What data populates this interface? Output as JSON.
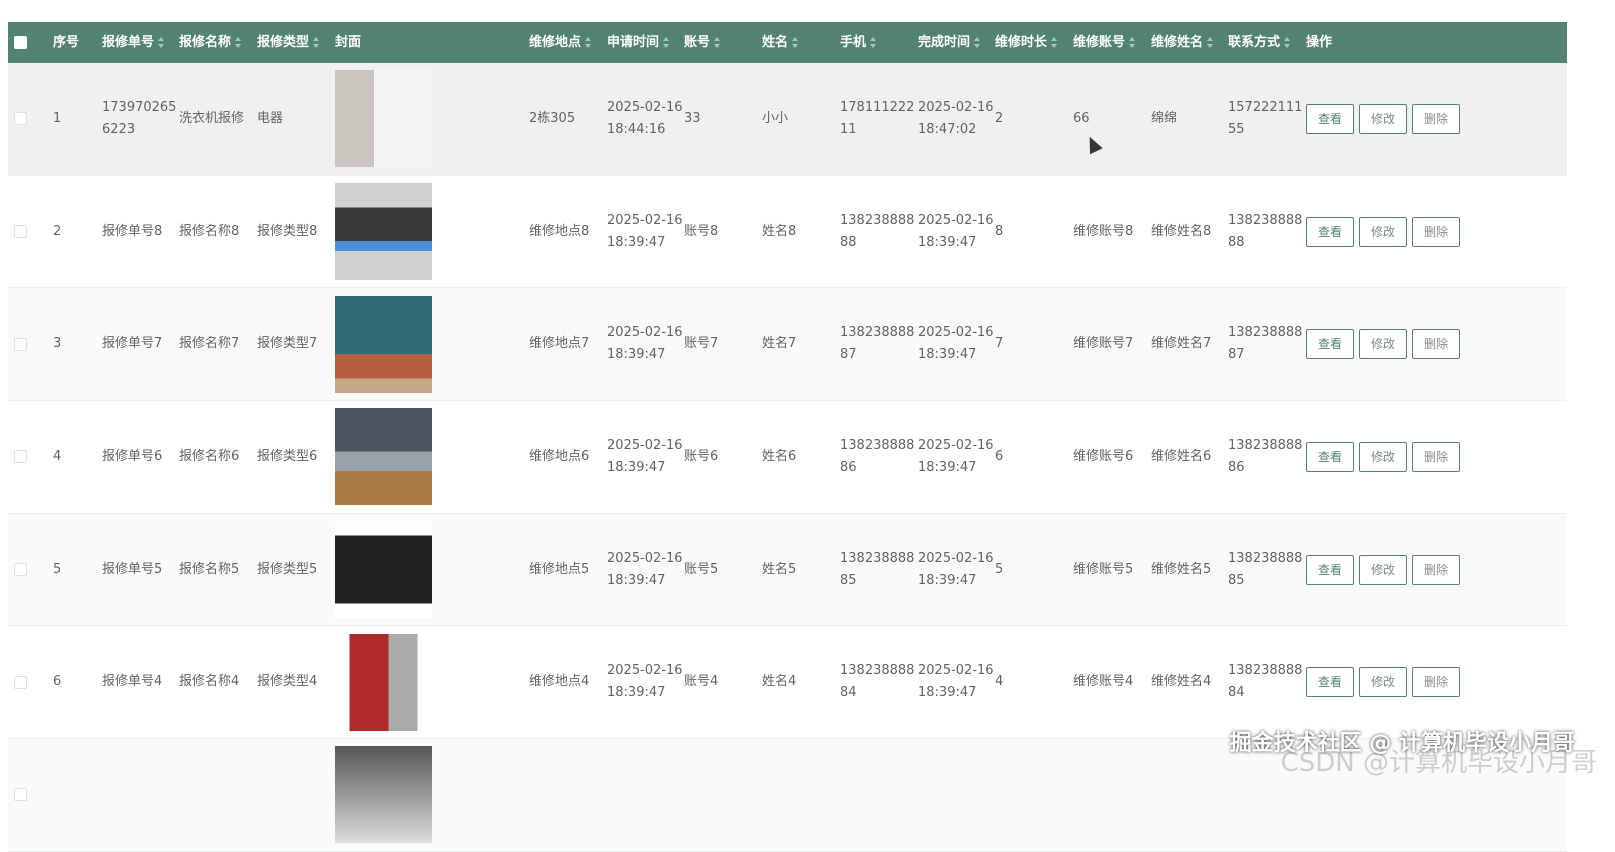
{
  "columns": [
    "序号",
    "报修单号",
    "报修名称",
    "报修类型",
    "封面",
    "维修地点",
    "申请时间",
    "账号",
    "姓名",
    "手机",
    "完成时间",
    "维修时长",
    "维修账号",
    "维修姓名",
    "联系方式",
    "操作"
  ],
  "sortable": [
    false,
    true,
    true,
    true,
    false,
    true,
    true,
    true,
    true,
    true,
    true,
    true,
    true,
    true,
    true,
    false
  ],
  "actions": {
    "view": "查看",
    "edit": "修改",
    "delete": "删除"
  },
  "rows": [
    {
      "idx": "1",
      "no": "1739702656223",
      "name": "洗衣机报修",
      "type": "电器",
      "cover": "washing-machine",
      "place": "2栋305",
      "apply": "2025-02-16 18:44:16",
      "account": "33",
      "uname": "小小",
      "phone": "17811122211",
      "done": "2025-02-16 18:47:02",
      "dur": "2",
      "racc": "66",
      "rname": "绵绵",
      "contact": "15722211155"
    },
    {
      "idx": "2",
      "no": "报修单号8",
      "name": "报修名称8",
      "type": "报修类型8",
      "cover": "air-conditioner",
      "place": "维修地点8",
      "apply": "2025-02-16 18:39:47",
      "account": "账号8",
      "uname": "姓名8",
      "phone": "13823888888",
      "done": "2025-02-16 18:39:47",
      "dur": "8",
      "racc": "维修账号8",
      "rname": "维修姓名8",
      "contact": "13823888888"
    },
    {
      "idx": "3",
      "no": "报修单号7",
      "name": "报修名称7",
      "type": "报修类型7",
      "cover": "food-processor",
      "place": "维修地点7",
      "apply": "2025-02-16 18:39:47",
      "account": "账号7",
      "uname": "姓名7",
      "phone": "13823888887",
      "done": "2025-02-16 18:39:47",
      "dur": "7",
      "racc": "维修账号7",
      "rname": "维修姓名7",
      "contact": "13823888887"
    },
    {
      "idx": "4",
      "no": "报修单号6",
      "name": "报修名称6",
      "type": "报修类型6",
      "cover": "kitchen",
      "place": "维修地点6",
      "apply": "2025-02-16 18:39:47",
      "account": "账号6",
      "uname": "姓名6",
      "phone": "13823888886",
      "done": "2025-02-16 18:39:47",
      "dur": "6",
      "racc": "维修账号6",
      "rname": "维修姓名6",
      "contact": "13823888886"
    },
    {
      "idx": "5",
      "no": "报修单号5",
      "name": "报修名称5",
      "type": "报修类型5",
      "cover": "microwave",
      "place": "维修地点5",
      "apply": "2025-02-16 18:39:47",
      "account": "账号5",
      "uname": "姓名5",
      "phone": "13823888885",
      "done": "2025-02-16 18:39:47",
      "dur": "5",
      "racc": "维修账号5",
      "rname": "维修姓名5",
      "contact": "13823888885"
    },
    {
      "idx": "6",
      "no": "报修单号4",
      "name": "报修名称4",
      "type": "报修类型4",
      "cover": "coffee-machine",
      "place": "维修地点4",
      "apply": "2025-02-16 18:39:47",
      "account": "账号4",
      "uname": "姓名4",
      "phone": "13823888884",
      "done": "2025-02-16 18:39:47",
      "dur": "4",
      "racc": "维修账号4",
      "rname": "维修姓名4",
      "contact": "13823888884"
    },
    {
      "idx": "",
      "no": "",
      "name": "",
      "type": "",
      "cover": "appliance",
      "place": "",
      "apply": "",
      "account": "",
      "uname": "",
      "phone": "",
      "done": "",
      "dur": "",
      "racc": "",
      "rname": "",
      "contact": ""
    }
  ],
  "watermark": "掘金技术社区 @ 计算机毕设小月哥",
  "watermark2": "CSDN @计算机毕设小月哥",
  "colors": {
    "header": "#528372",
    "accent": "#528372"
  }
}
